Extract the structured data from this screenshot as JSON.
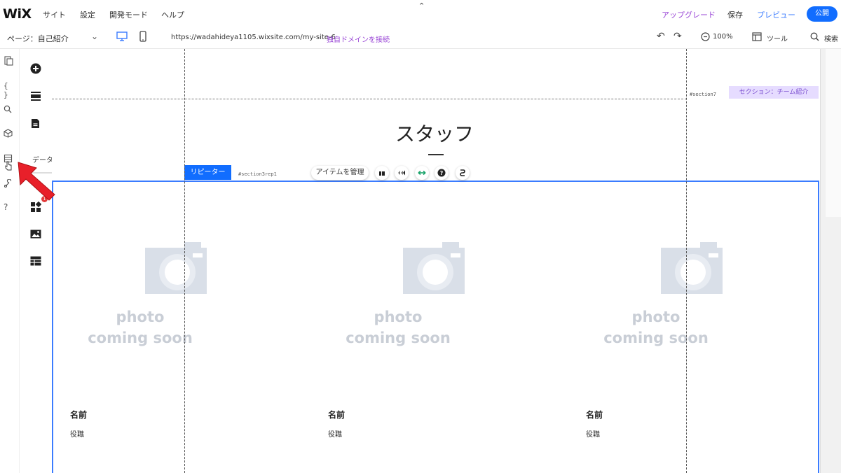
{
  "topbar": {
    "logo": "WiX",
    "menu": [
      "サイト",
      "設定",
      "開発モード",
      "ヘルプ"
    ],
    "upgrade": "アップグレード",
    "save": "保存",
    "preview": "プレビュー",
    "publish": "公開"
  },
  "subbar": {
    "page": "ページ：自己紹介",
    "url": "https://wadahideya1105.wixsite.com/my-site-6",
    "connect_domain": "独自ドメインを接続",
    "zoom": "100%",
    "tools": "ツール",
    "search": "検索"
  },
  "left_rail": {
    "tooltip": "データベース",
    "badge": "1"
  },
  "canvas": {
    "section_id": "#section7",
    "section_tag": "セクション：チーム紹介",
    "title": "スタッフ",
    "repeater_tag": "リピーター",
    "repeater_id": "#section3rep1",
    "manage_items": "アイテムを管理",
    "photo_line1": "photo",
    "photo_line2": "coming soon",
    "cards": [
      {
        "name": "名前",
        "role": "役職"
      },
      {
        "name": "名前",
        "role": "役職"
      },
      {
        "name": "名前",
        "role": "役職"
      }
    ]
  },
  "colors": {
    "accent": "#116dff",
    "purple": "#9a47d6",
    "arrow": "#e8202a"
  }
}
